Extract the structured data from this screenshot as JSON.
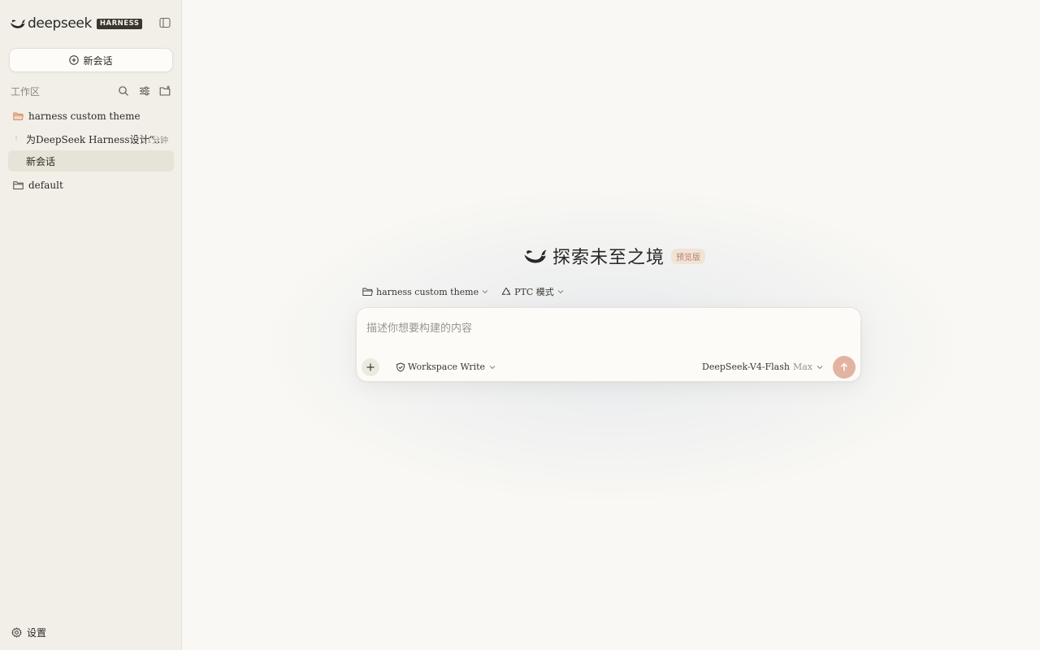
{
  "brand": {
    "name": "deepseek",
    "tag": "HARNESS",
    "logo_icon": "whale-logo-icon"
  },
  "sidebar": {
    "toggle_icon": "sidebar-toggle-icon",
    "new_chat_label": "新会话",
    "workspace_label": "工作区",
    "workspace_actions": [
      "search-icon",
      "filter-icon",
      "new-folder-icon"
    ],
    "folders": [
      {
        "name": "harness custom theme",
        "icon": "folder-open-icon",
        "open": true,
        "items": [
          {
            "title": "为DeepSeek Harness设计“...",
            "time": "21分钟",
            "marker": "⁝",
            "active": false
          },
          {
            "title": "新会话",
            "time": "",
            "marker": "",
            "active": true
          }
        ]
      },
      {
        "name": "default",
        "icon": "folder-icon",
        "open": false,
        "items": []
      }
    ],
    "settings_label": "设置"
  },
  "main": {
    "hero": {
      "title": "探索未至之境",
      "badge": "预览版"
    },
    "context": {
      "folder": "harness custom theme",
      "mode": "PTC 模式"
    },
    "composer": {
      "placeholder": "描述你想要构建的内容",
      "value": "",
      "permission": "Workspace Write",
      "model": "DeepSeek-V4-Flash",
      "effort": "Max"
    }
  },
  "colors": {
    "sidebar_bg": "#f1efe8",
    "main_bg": "#f9f8f4",
    "active_item_bg": "#e7e3d8",
    "send_button": "#e3b3a2",
    "badge_bg": "#f1e3d6",
    "badge_text": "#b7826a"
  }
}
